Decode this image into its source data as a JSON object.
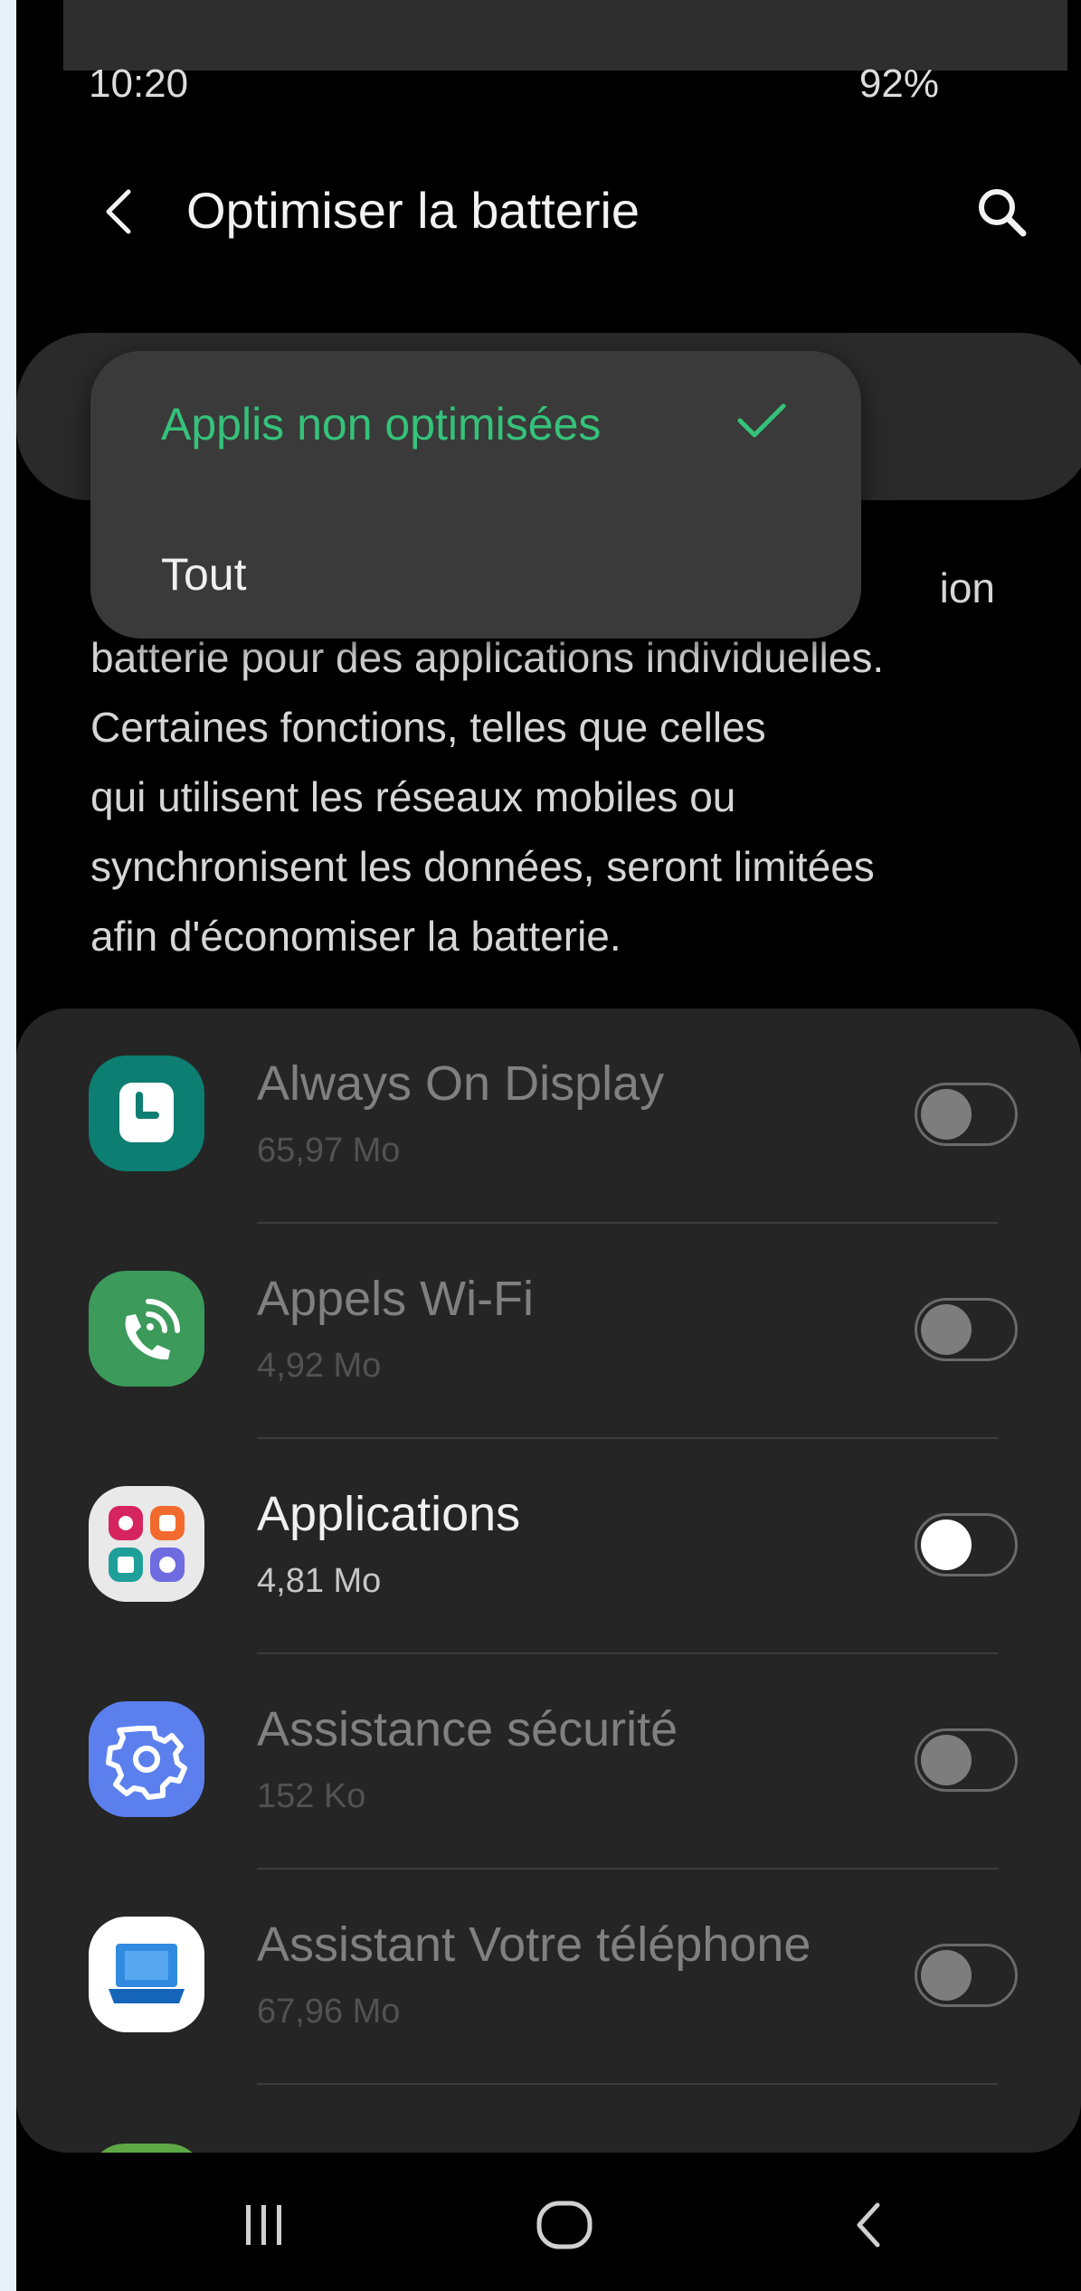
{
  "status_bar": {
    "time": "10:20",
    "battery": "92%"
  },
  "header": {
    "title": "Optimiser la batterie"
  },
  "dropdown": {
    "options": [
      {
        "label": "Applis non optimisées",
        "selected": true
      },
      {
        "label": "Tout",
        "selected": false
      }
    ]
  },
  "description_lines": [
    "ion",
    "batterie pour des applications individuelles.",
    "Certaines fonctions, telles que celles",
    "qui utilisent les réseaux mobiles ou",
    "synchronisent les données, seront limitées",
    "afin d'économiser la batterie."
  ],
  "apps": [
    {
      "name": "Always On Display",
      "size": "65,97 Mo",
      "icon": "clock-icon",
      "enabled": false
    },
    {
      "name": "Appels Wi-Fi",
      "size": "4,92 Mo",
      "icon": "wifi-call-icon",
      "enabled": false
    },
    {
      "name": "Applications",
      "size": "4,81 Mo",
      "icon": "apps-folder-icon",
      "enabled": true
    },
    {
      "name": "Assistance sécurité",
      "size": "152 Ko",
      "icon": "gear-icon",
      "enabled": false
    },
    {
      "name": "Assistant Votre téléphone",
      "size": "67,96 Mo",
      "icon": "laptop-icon",
      "enabled": false
    }
  ],
  "colors": {
    "accent_green": "#35c27a",
    "background": "#000000",
    "card": "#252525",
    "dropdown": "#3a3a3a"
  }
}
